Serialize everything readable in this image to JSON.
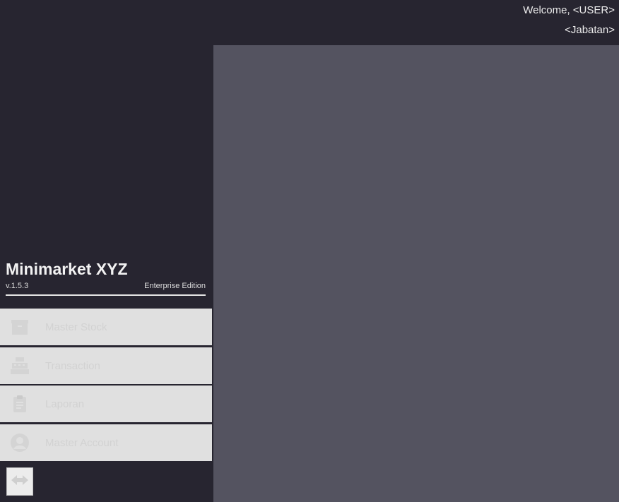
{
  "header": {
    "welcome": "Welcome, <USER>",
    "jabatan": "<Jabatan>"
  },
  "brand": {
    "title": "Minimarket XYZ",
    "version": "v.1.5.3",
    "edition": "Enterprise Edition"
  },
  "menu": {
    "items": [
      {
        "label": "Master Stock",
        "icon": "box-icon"
      },
      {
        "label": "Transaction",
        "icon": "cash-register-icon"
      },
      {
        "label": "Laporan",
        "icon": "clipboard-icon"
      },
      {
        "label": "Master Account",
        "icon": "user-icon"
      }
    ]
  },
  "colors": {
    "background": "#272530",
    "content": "#545360",
    "menu_bg": "#e0e0e0",
    "menu_text": "#d2d2d2"
  }
}
